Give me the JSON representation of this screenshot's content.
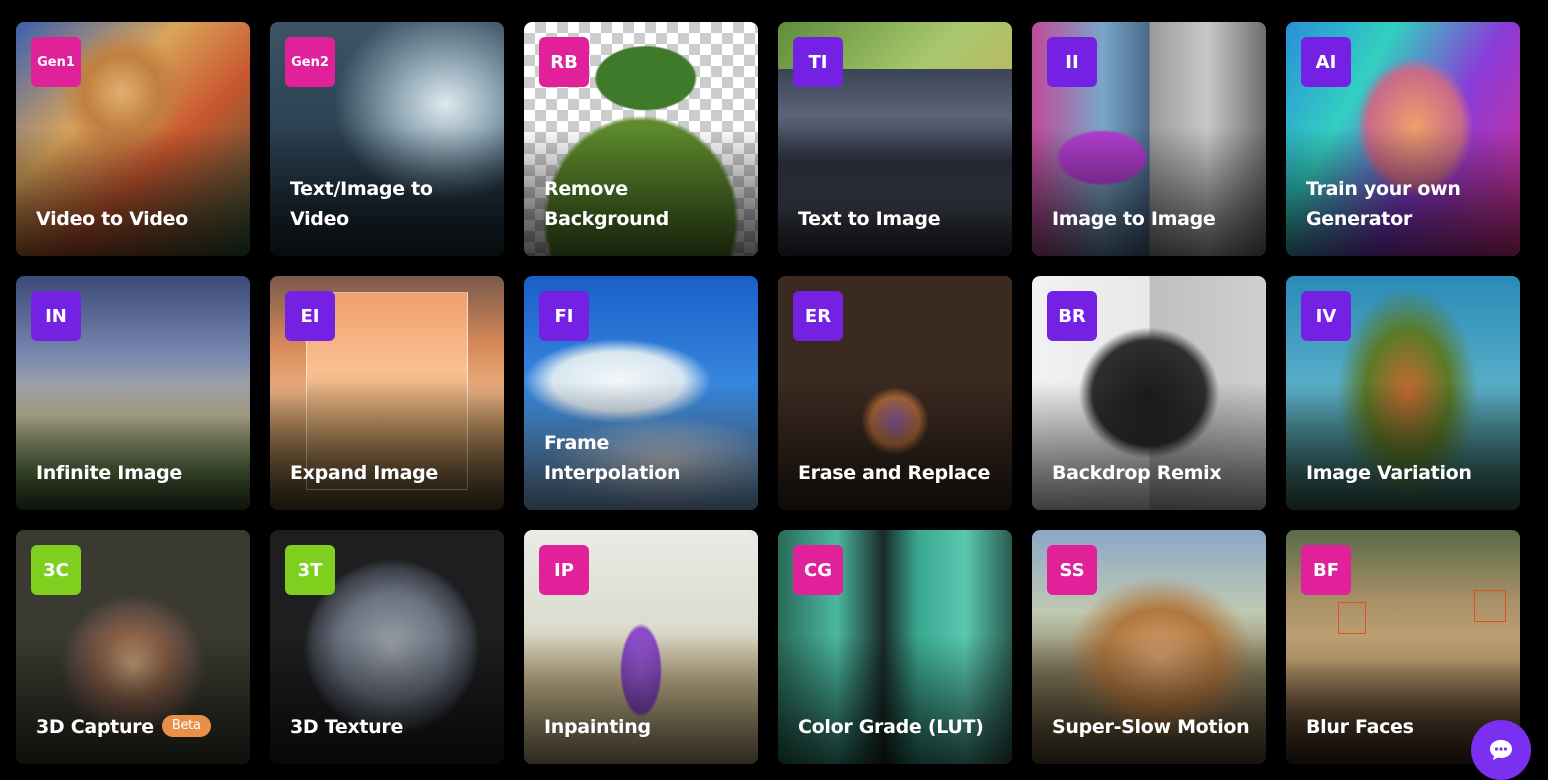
{
  "colors": {
    "pink": "#e0219a",
    "purple": "#7421e3",
    "lime": "#7fcf1e",
    "beta": "#e8904a",
    "chat": "#7b2ff0"
  },
  "tools": [
    {
      "badge": "Gen1",
      "label": "Video to Video"
    },
    {
      "badge": "Gen2",
      "label": "Text/Image to Video"
    },
    {
      "badge": "RB",
      "label": "Remove Background"
    },
    {
      "badge": "TI",
      "label": "Text to Image"
    },
    {
      "badge": "II",
      "label": "Image to Image"
    },
    {
      "badge": "AI",
      "label": "Train your own Generator"
    },
    {
      "badge": "IN",
      "label": "Infinite Image"
    },
    {
      "badge": "EI",
      "label": "Expand Image"
    },
    {
      "badge": "FI",
      "label": "Frame Interpolation"
    },
    {
      "badge": "ER",
      "label": "Erase and Replace"
    },
    {
      "badge": "BR",
      "label": "Backdrop Remix"
    },
    {
      "badge": "IV",
      "label": "Image Variation"
    },
    {
      "badge": "3C",
      "label": "3D Capture",
      "tag": "Beta"
    },
    {
      "badge": "3T",
      "label": "3D Texture"
    },
    {
      "badge": "IP",
      "label": "Inpainting"
    },
    {
      "badge": "CG",
      "label": "Color Grade (LUT)"
    },
    {
      "badge": "SS",
      "label": "Super-Slow Motion"
    },
    {
      "badge": "BF",
      "label": "Blur Faces"
    }
  ],
  "chat_button": {
    "icon": "chat-bubble-icon"
  }
}
